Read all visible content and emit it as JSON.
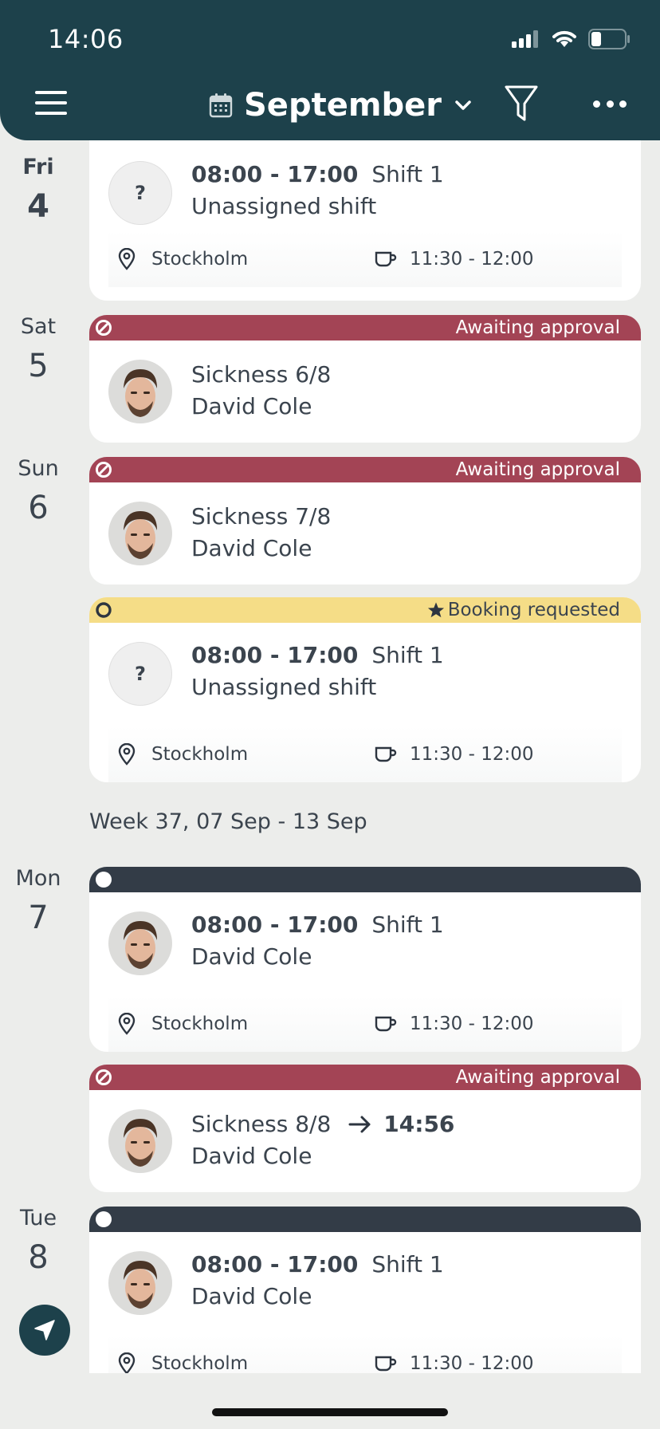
{
  "status_bar": {
    "time": "14:06"
  },
  "header": {
    "month": "September"
  },
  "days": {
    "fri": {
      "abbr": "Fri",
      "num": "4"
    },
    "sat": {
      "abbr": "Sat",
      "num": "5"
    },
    "sun": {
      "abbr": "Sun",
      "num": "6"
    },
    "mon": {
      "abbr": "Mon",
      "num": "7"
    },
    "tue": {
      "abbr": "Tue",
      "num": "8"
    }
  },
  "week_label": "Week 37, 07 Sep - 13 Sep",
  "cards": [
    {
      "time": "08:00 - 17:00",
      "shift": "Shift 1",
      "person": "Unassigned shift",
      "avatar": "?",
      "location": "Stockholm",
      "break": "11:30 - 12:00"
    },
    {
      "status": "Awaiting approval",
      "title": "Sickness 6/8",
      "person": "David Cole"
    },
    {
      "status": "Awaiting approval",
      "title": "Sickness 7/8",
      "person": "David Cole"
    },
    {
      "status": "Booking requested",
      "time": "08:00 - 17:00",
      "shift": "Shift 1",
      "person": "Unassigned shift",
      "avatar": "?",
      "location": "Stockholm",
      "break": "11:30 - 12:00"
    },
    {
      "time": "08:00 - 17:00",
      "shift": "Shift 1",
      "person": "David Cole",
      "location": "Stockholm",
      "break": "11:30 - 12:00"
    },
    {
      "status": "Awaiting approval",
      "title": "Sickness 8/8",
      "end_time": "14:56",
      "person": "David Cole"
    },
    {
      "time": "08:00 - 17:00",
      "shift": "Shift 1",
      "person": "David Cole",
      "location": "Stockholm",
      "break": "11:30 - 12:00"
    }
  ],
  "colors": {
    "header": "#1d414b",
    "awaiting": "#a34455",
    "booking": "#f5dd87",
    "assigned": "#333c47",
    "background": "#ecedeb"
  },
  "icons": [
    "menu-icon",
    "calendar-icon",
    "chevron-down-icon",
    "filter-icon",
    "more-icon",
    "location-pin-icon",
    "coffee-cup-icon",
    "blocked-icon",
    "star-icon",
    "navigate-icon"
  ]
}
